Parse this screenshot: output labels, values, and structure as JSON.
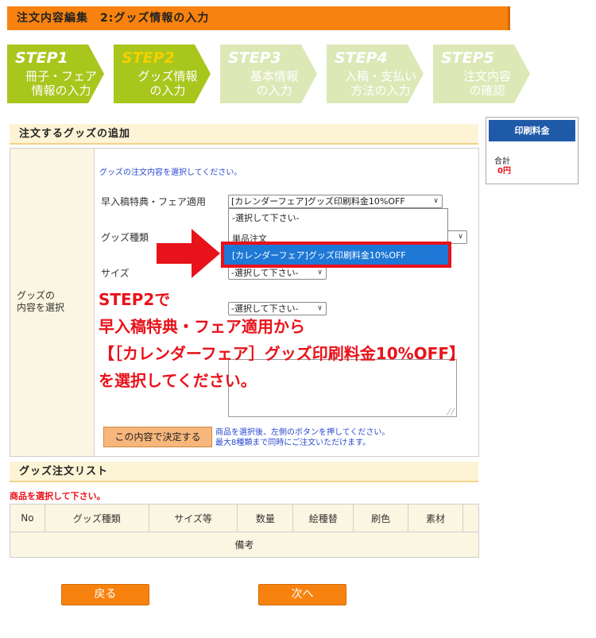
{
  "header": {
    "title": "注文内容編集　2:グッズ情報の入力"
  },
  "steps": [
    {
      "num": "STEP1",
      "label1": "冊子・フェア",
      "label2": "情報の入力",
      "state": "active"
    },
    {
      "num": "STEP2",
      "label1": "グッズ情報",
      "label2": "の入力",
      "state": "active"
    },
    {
      "num": "STEP3",
      "label1": "基本情報",
      "label2": "の入力",
      "state": "inactive"
    },
    {
      "num": "STEP4",
      "label1": "入稿・支払い",
      "label2": "方法の入力",
      "state": "inactive"
    },
    {
      "num": "STEP5",
      "label1": "注文内容",
      "label2": "の確認",
      "state": "inactive"
    }
  ],
  "add_section": {
    "title": "注文するグッズの追加"
  },
  "form": {
    "left_label_1": "グッズの",
    "left_label_2": "内容を選択",
    "instruction": "グッズの注文内容を選択してください。",
    "fair_label": "早入稿特典・フェア適用",
    "fair_value": "[カレンダーフェア]グッズ印刷料金10%OFF",
    "goods_type_label": "グッズ種類",
    "size_label": "サイズ",
    "size_value": "-選択して下さい-",
    "extra_select_value": "-選択して下さい-",
    "dropdown_options": [
      "-選択して下さい-",
      "単品注文",
      "[カレンダーフェア]グッズ印刷料金10%OFF"
    ],
    "decide_button": "この内容で決定する",
    "decide_note_1": "商品を選択後、左側のボタンを押してください。",
    "decide_note_2": "最大8種類まで同時にご注文いただけます。"
  },
  "overlay": {
    "line1": "STEP2で",
    "line2": "早入稿特典・フェア適用から",
    "line3": "【［カレンダーフェア］グッズ印刷料金10%OFF】",
    "line4": "を選択してください。"
  },
  "side": {
    "head": "印刷料金",
    "total_label": "合計",
    "total_value": "0円"
  },
  "list_section": {
    "title": "グッズ注文リスト",
    "warning": "商品を選択して下さい。",
    "columns": [
      "No",
      "グッズ種類",
      "サイズ等",
      "数量",
      "絵種替",
      "刷色",
      "素材"
    ],
    "remarks": "備考"
  },
  "buttons": {
    "back": "戻る",
    "next": "次へ"
  },
  "colors": {
    "accent": "#f7820f",
    "step_active": "#a8c61c",
    "highlight": "#e8121a",
    "select_blue": "#1e78d6"
  }
}
